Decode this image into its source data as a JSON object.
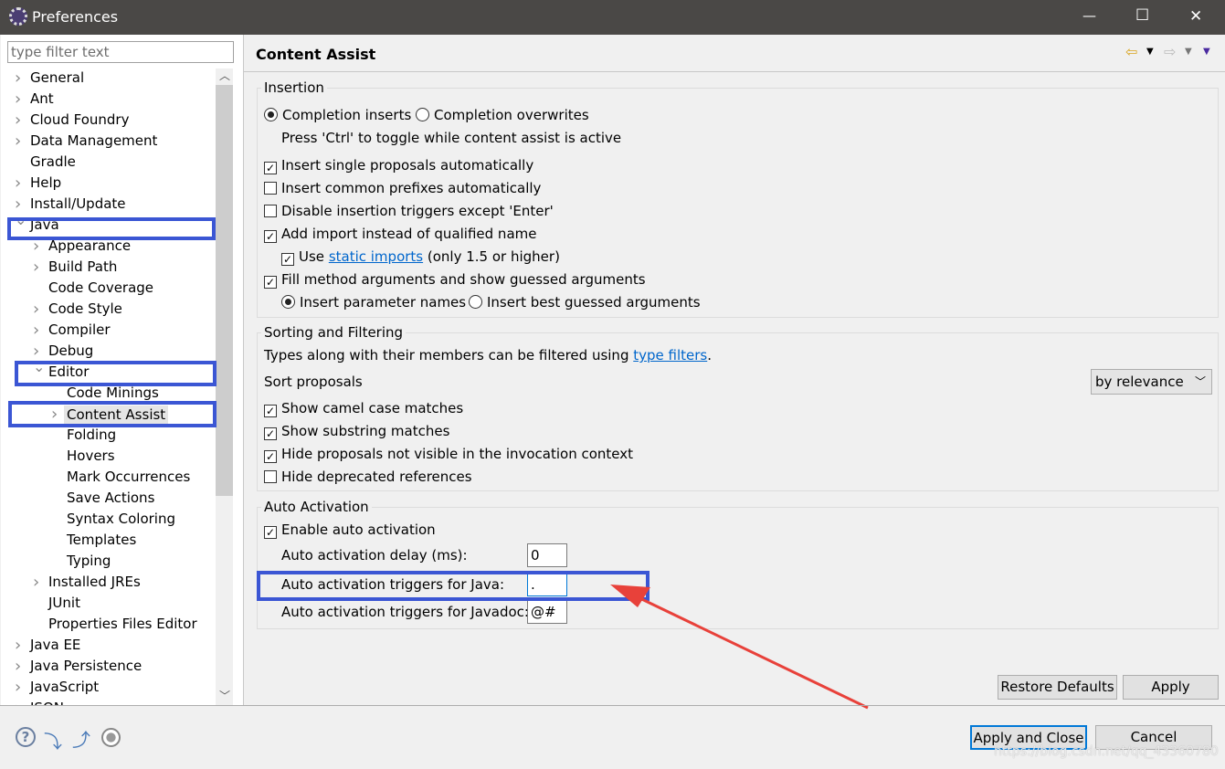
{
  "window": {
    "title": "Preferences",
    "minimize": "—",
    "maximize": "☐",
    "close": "✕"
  },
  "filter": {
    "placeholder": "type filter text"
  },
  "tree": [
    {
      "label": "General",
      "level": 0,
      "exp": ">"
    },
    {
      "label": "Ant",
      "level": 0,
      "exp": ">"
    },
    {
      "label": "Cloud Foundry",
      "level": 0,
      "exp": ">"
    },
    {
      "label": "Data Management",
      "level": 0,
      "exp": ">"
    },
    {
      "label": "Gradle",
      "level": 0,
      "exp": ""
    },
    {
      "label": "Help",
      "level": 0,
      "exp": ">"
    },
    {
      "label": "Install/Update",
      "level": 0,
      "exp": ">"
    },
    {
      "label": "Java",
      "level": 0,
      "exp": "v"
    },
    {
      "label": "Appearance",
      "level": 1,
      "exp": ">"
    },
    {
      "label": "Build Path",
      "level": 1,
      "exp": ">"
    },
    {
      "label": "Code Coverage",
      "level": 1,
      "exp": ""
    },
    {
      "label": "Code Style",
      "level": 1,
      "exp": ">"
    },
    {
      "label": "Compiler",
      "level": 1,
      "exp": ">"
    },
    {
      "label": "Debug",
      "level": 1,
      "exp": ">"
    },
    {
      "label": "Editor",
      "level": 1,
      "exp": "v"
    },
    {
      "label": "Code Minings",
      "level": 2,
      "exp": ""
    },
    {
      "label": "Content Assist",
      "level": 2,
      "exp": ">",
      "selected": true
    },
    {
      "label": "Folding",
      "level": 2,
      "exp": ""
    },
    {
      "label": "Hovers",
      "level": 2,
      "exp": ""
    },
    {
      "label": "Mark Occurrences",
      "level": 2,
      "exp": ""
    },
    {
      "label": "Save Actions",
      "level": 2,
      "exp": ""
    },
    {
      "label": "Syntax Coloring",
      "level": 2,
      "exp": ""
    },
    {
      "label": "Templates",
      "level": 2,
      "exp": ""
    },
    {
      "label": "Typing",
      "level": 2,
      "exp": ""
    },
    {
      "label": "Installed JREs",
      "level": 1,
      "exp": ">"
    },
    {
      "label": "JUnit",
      "level": 1,
      "exp": ""
    },
    {
      "label": "Properties Files Editor",
      "level": 1,
      "exp": ""
    },
    {
      "label": "Java EE",
      "level": 0,
      "exp": ">"
    },
    {
      "label": "Java Persistence",
      "level": 0,
      "exp": ">"
    },
    {
      "label": "JavaScript",
      "level": 0,
      "exp": ">"
    },
    {
      "label": "JSON",
      "level": 0,
      "exp": ">"
    }
  ],
  "page": {
    "title": "Content Assist",
    "insertion": {
      "label": "Insertion",
      "completion_inserts": "Completion inserts",
      "completion_overwrites": "Completion overwrites",
      "toggle_hint": "Press 'Ctrl' to toggle while content assist is active",
      "single_proposals": "Insert single proposals automatically",
      "common_prefixes": "Insert common prefixes automatically",
      "disable_triggers": "Disable insertion triggers except 'Enter'",
      "add_import": "Add import instead of qualified name",
      "use": "Use",
      "static_imports": "static imports",
      "only_15": "(only 1.5 or higher)",
      "fill_method": "Fill method arguments and show guessed arguments",
      "param_names": "Insert parameter names",
      "best_guessed": "Insert best guessed arguments"
    },
    "sorting": {
      "label": "Sorting and Filtering",
      "types_text": "Types along with their members can be filtered using",
      "type_filters": "type filters",
      "period": ".",
      "sort_label": "Sort proposals",
      "sort_value": "by relevance",
      "camel": "Show camel case matches",
      "substring": "Show substring matches",
      "hide_not_visible": "Hide proposals not visible in the invocation context",
      "hide_deprecated": "Hide deprecated references"
    },
    "auto": {
      "label": "Auto Activation",
      "enable": "Enable auto activation",
      "delay_label": "Auto activation delay (ms):",
      "delay_value": "0",
      "java_label": "Auto activation triggers for Java:",
      "java_value": ".",
      "javadoc_label": "Auto activation triggers for Javadoc:",
      "javadoc_value": "@#"
    },
    "restore": "Restore Defaults",
    "apply": "Apply"
  },
  "footer": {
    "apply_close": "Apply and Close",
    "cancel": "Cancel",
    "watermark": "https://blog.csdn.net/qq_43360780"
  },
  "colors": {
    "highlight": "#3b56d4",
    "arrow": "#e8413a",
    "titlebar": "#4a4846"
  }
}
